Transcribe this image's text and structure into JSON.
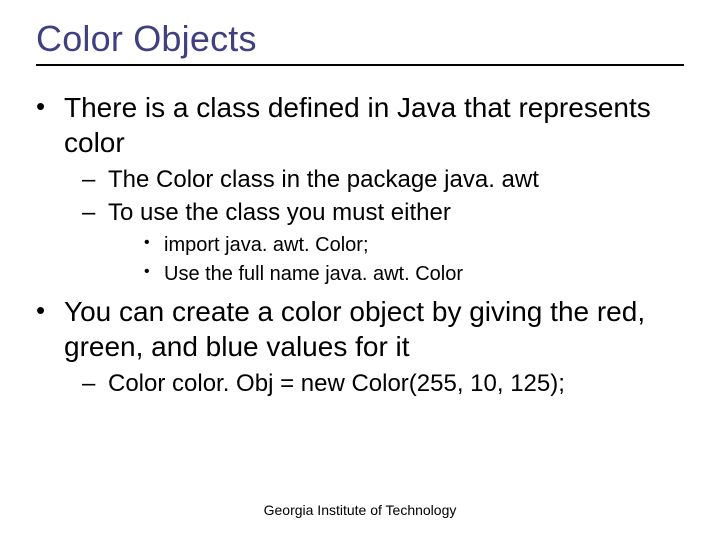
{
  "title": "Color Objects",
  "bullets": {
    "b1": "There is a class defined in Java that represents color",
    "b1_sub1": "The Color class in the package java. awt",
    "b1_sub2": "To use the class you must either",
    "b1_sub2_s1": "import java. awt. Color;",
    "b1_sub2_s2": "Use the full name java. awt. Color",
    "b2": "You can create a color object by giving the red, green, and blue values for it",
    "b2_sub1": "Color color. Obj = new Color(255, 10, 125);"
  },
  "footer": "Georgia Institute of Technology"
}
